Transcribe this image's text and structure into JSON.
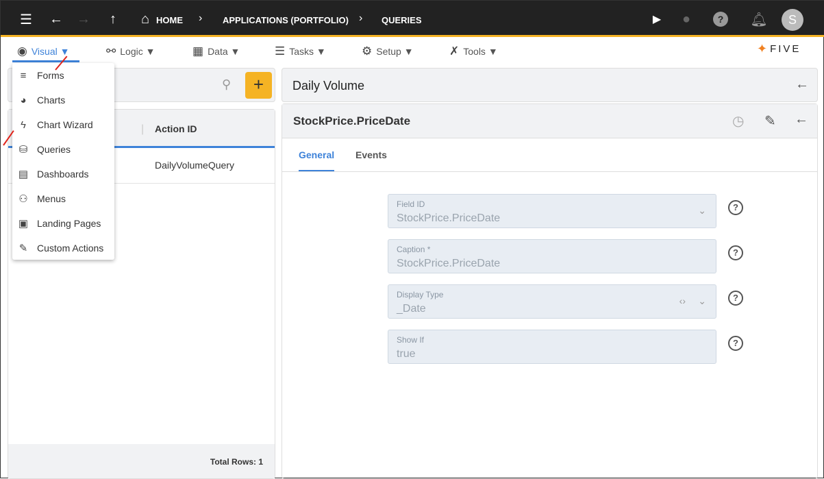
{
  "topbar": {
    "crumbs": [
      "HOME",
      "APPLICATIONS (PORTFOLIO)",
      "QUERIES"
    ],
    "avatar": "S"
  },
  "menubar": {
    "items": [
      {
        "label": "Visual ▼",
        "icon": "eye-icon"
      },
      {
        "label": "Logic ▼",
        "icon": "logic-icon"
      },
      {
        "label": "Data ▼",
        "icon": "table-icon"
      },
      {
        "label": "Tasks ▼",
        "icon": "checklist-icon"
      },
      {
        "label": "Setup ▼",
        "icon": "gear-icon"
      },
      {
        "label": "Tools ▼",
        "icon": "tools-icon"
      }
    ],
    "logo": "FIVE"
  },
  "dropdown": {
    "items": [
      "Forms",
      "Charts",
      "Chart Wizard",
      "Queries",
      "Dashboards",
      "Menus",
      "Landing Pages",
      "Custom Actions"
    ]
  },
  "list": {
    "column": "Action ID",
    "rows": [
      "DailyVolumeQuery"
    ],
    "footer": "Total Rows: 1"
  },
  "detail": {
    "title": "Daily Volume",
    "subtitle": "StockPrice.PriceDate",
    "tabs": [
      "General",
      "Events"
    ],
    "fields": [
      {
        "label": "Field ID",
        "value": "StockPrice.PriceDate"
      },
      {
        "label": "Caption *",
        "value": "StockPrice.PriceDate"
      },
      {
        "label": "Display Type",
        "value": "_Date"
      },
      {
        "label": "Show If",
        "value": "true"
      }
    ]
  },
  "colors": {
    "accent": "#3d82d9",
    "add": "#f5b324"
  }
}
